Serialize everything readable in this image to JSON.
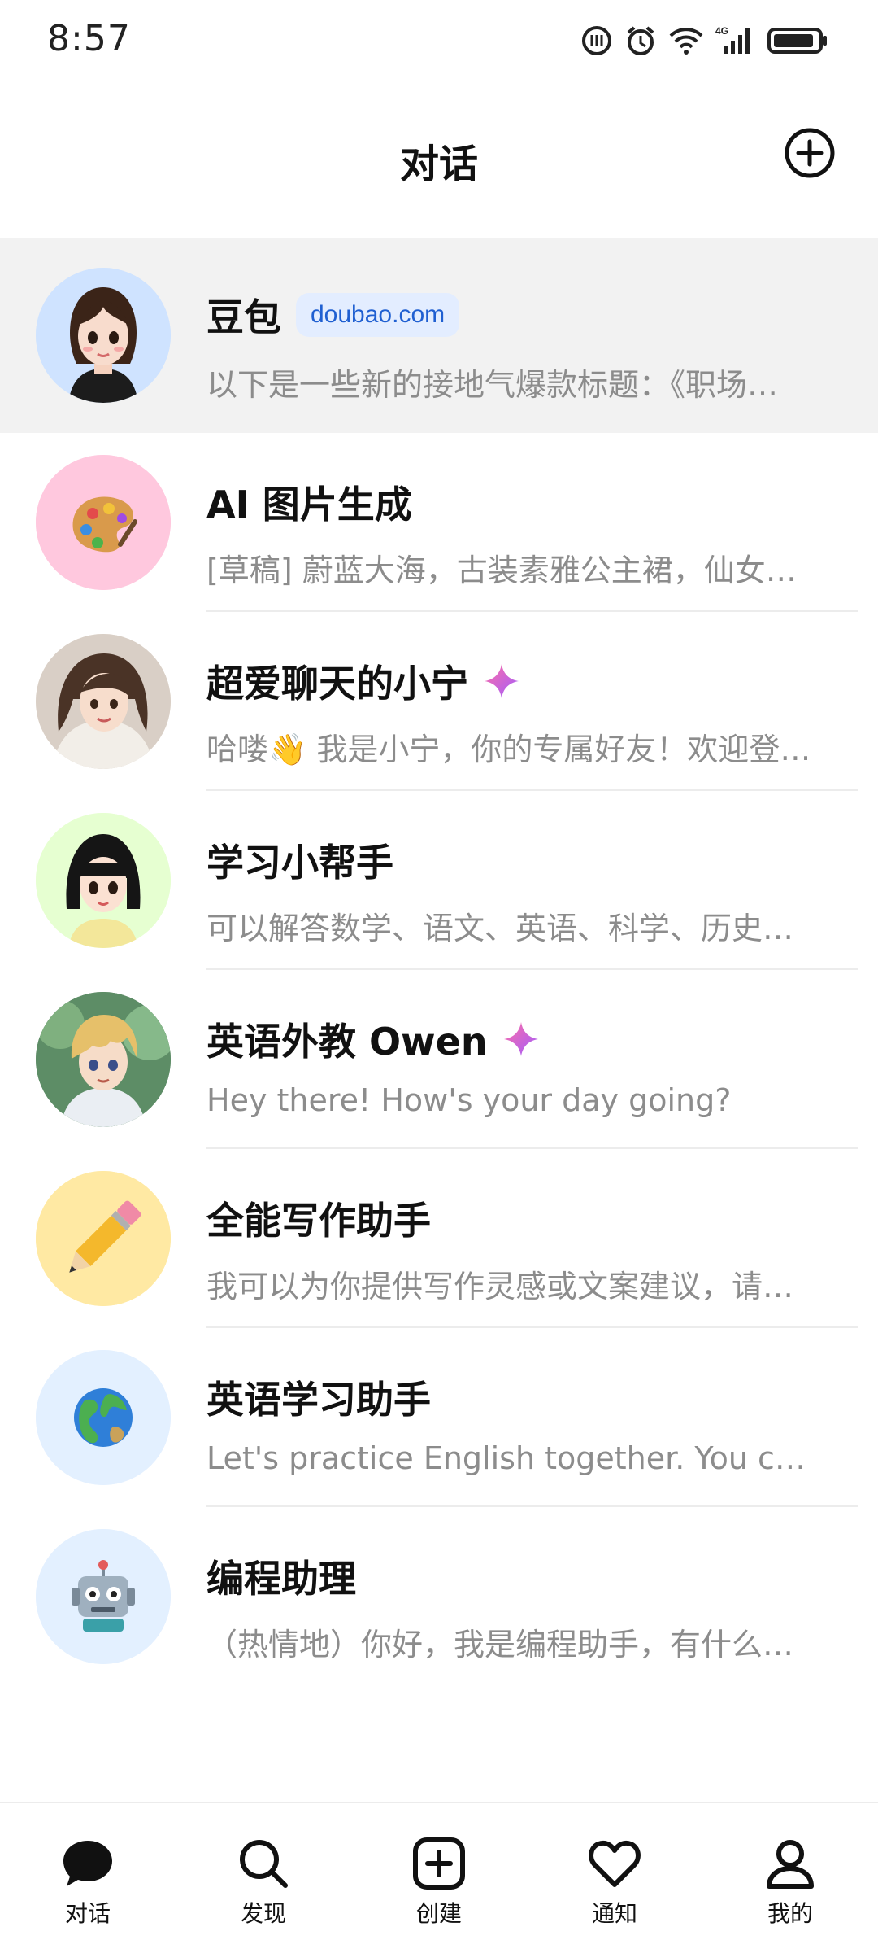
{
  "status_bar": {
    "time": "8:57",
    "icons": [
      "data-saver-icon",
      "alarm-icon",
      "wifi-icon",
      "signal-4g-icon",
      "battery-icon"
    ],
    "network": "4G"
  },
  "header": {
    "title": "对话",
    "add_icon": "add-circle-icon"
  },
  "conversations": [
    {
      "name": "豆包",
      "badge": "doubao.com",
      "preview": "以下是一些新的接地气爆款标题：《职场…",
      "avatar": "girl-portrait",
      "avatar_bg": "#cfe3ff",
      "sparkle": false
    },
    {
      "name": "AI 图片生成",
      "preview": "[草稿] 蔚蓝大海，古装素雅公主裙，仙女…",
      "avatar": "palette-icon",
      "avatar_bg": "#ffc8de",
      "sparkle": false
    },
    {
      "name": "超爱聊天的小宁",
      "preview": "哈喽👋 我是小宁，你的专属好友！欢迎登…",
      "avatar": "woman-portrait",
      "avatar_bg": "#e8dccf",
      "sparkle": true
    },
    {
      "name": "学习小帮手",
      "preview": "可以解答数学、语文、英语、科学、历史…",
      "avatar": "student-girl-portrait",
      "avatar_bg": "#e6ffd1",
      "sparkle": false
    },
    {
      "name": "英语外教 Owen",
      "preview": "Hey there! How's your day going?",
      "avatar": "anime-boy-portrait",
      "avatar_bg": "#4f7d5a",
      "sparkle": true
    },
    {
      "name": "全能写作助手",
      "preview": "我可以为你提供写作灵感或文案建议，请…",
      "avatar": "pencil-icon",
      "avatar_bg": "#ffe9a3",
      "sparkle": false
    },
    {
      "name": "英语学习助手",
      "preview": "Let's practice English together. You can t…",
      "avatar": "globe-icon",
      "avatar_bg": "#e3f0ff",
      "sparkle": false
    },
    {
      "name": "编程助理",
      "preview": "（热情地）你好，我是编程助手，有什么…",
      "avatar": "robot-icon",
      "avatar_bg": "#e3f0ff",
      "sparkle": false
    }
  ],
  "bottom_nav": [
    {
      "label": "对话",
      "icon": "chat-bubble-icon",
      "active": true
    },
    {
      "label": "发现",
      "icon": "search-icon",
      "active": false
    },
    {
      "label": "创建",
      "icon": "create-plus-icon",
      "active": false
    },
    {
      "label": "通知",
      "icon": "heart-icon",
      "active": false
    },
    {
      "label": "我的",
      "icon": "profile-icon",
      "active": false
    }
  ],
  "colors": {
    "badge_bg": "#e3edff",
    "badge_text": "#1f5fd1",
    "preview_text": "#8c8c8c",
    "selected_row_bg": "#f2f2f2",
    "sparkle_start": "#ff6fa6",
    "sparkle_end": "#a05cff"
  }
}
